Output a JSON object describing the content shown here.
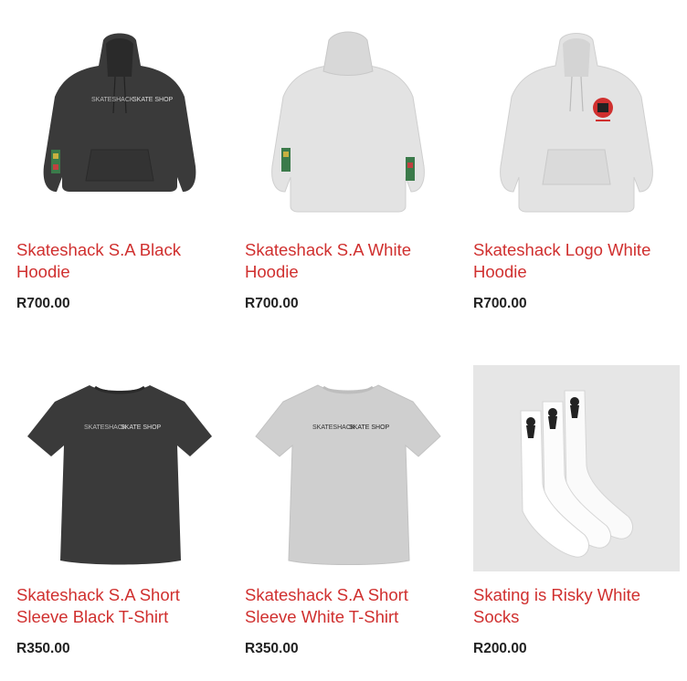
{
  "products": [
    {
      "title_line1": "Skateshack S.A Black",
      "title_line2": "Hoodie",
      "price": "R700.00",
      "image": "black-hoodie-image",
      "print_left": "SKATESHACK",
      "print_right": "SKATE SHOP"
    },
    {
      "title_line1": "Skateshack S.A White",
      "title_line2": "Hoodie",
      "price": "R700.00",
      "image": "white-hoodie-back-image"
    },
    {
      "title_line1": "Skateshack Logo White",
      "title_line2": "Hoodie",
      "price": "R700.00",
      "image": "white-logo-hoodie-image"
    },
    {
      "title_line1": "Skateshack S.A Short",
      "title_line2": "Sleeve Black T-Shirt",
      "price": "R350.00",
      "image": "black-tshirt-image",
      "print_left": "SKATESHACK",
      "print_right": "SKATE SHOP"
    },
    {
      "title_line1": "Skateshack S.A Short",
      "title_line2": "Sleeve White T-Shirt",
      "price": "R350.00",
      "image": "white-tshirt-image",
      "print_left": "SKATESHACK",
      "print_right": "SKATE SHOP"
    },
    {
      "title_line1": "Skating is Risky White",
      "title_line2": "Socks",
      "price": "R200.00",
      "image": "white-socks-image"
    }
  ],
  "colors": {
    "title": "#d0302f",
    "price": "#222222",
    "black_garment": "#3a3a3a",
    "white_garment": "#e3e3e3",
    "grey_garment": "#cfcfcf"
  }
}
